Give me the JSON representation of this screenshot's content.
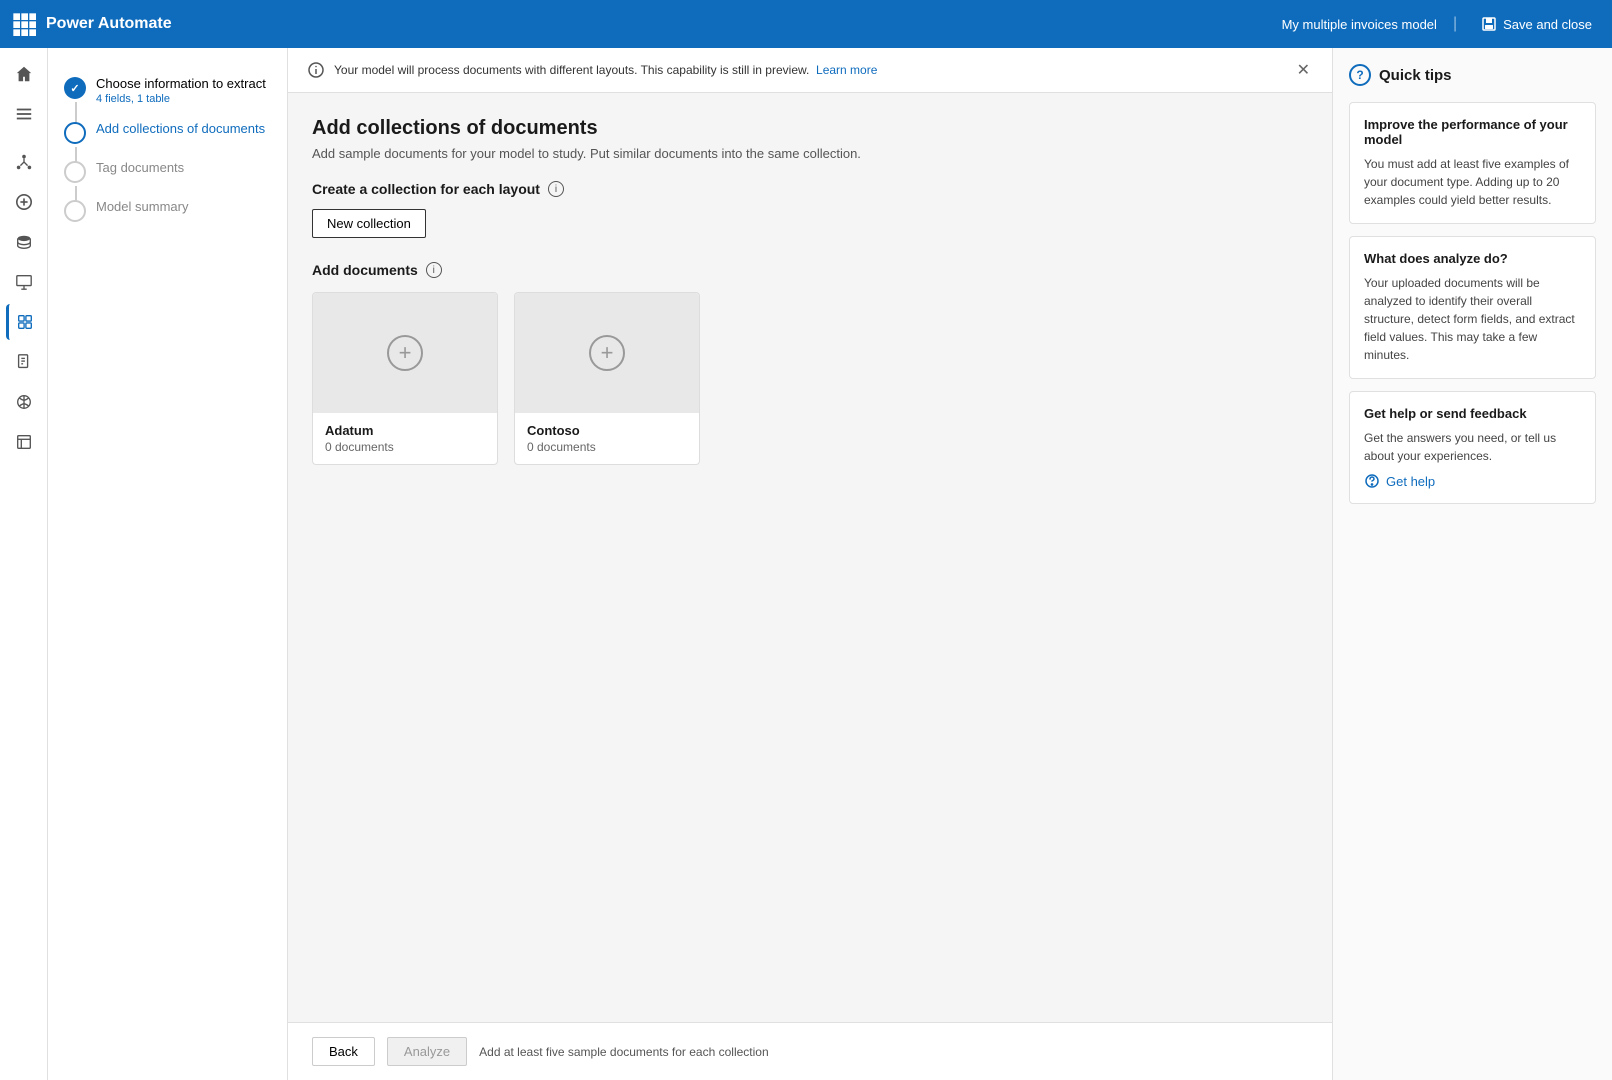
{
  "app": {
    "title": "Power Automate",
    "model_name": "My multiple invoices model",
    "save_close_label": "Save and close"
  },
  "banner": {
    "message": "Your model will process documents with different layouts. This capability is still in preview.",
    "learn_more": "Learn more"
  },
  "steps": [
    {
      "id": "choose-info",
      "title": "Choose information to extract",
      "subtitle": "4 fields, 1 table",
      "state": "completed"
    },
    {
      "id": "add-collections",
      "title": "Add collections of documents",
      "subtitle": "",
      "state": "active"
    },
    {
      "id": "tag-documents",
      "title": "Tag documents",
      "subtitle": "",
      "state": "inactive"
    },
    {
      "id": "model-summary",
      "title": "Model summary",
      "subtitle": "",
      "state": "inactive"
    }
  ],
  "main": {
    "page_title": "Add collections of documents",
    "page_subtitle": "Add sample documents for your model to study. Put similar documents into the same collection.",
    "create_collection_label": "Create a collection for each layout",
    "new_collection_btn": "New collection",
    "add_documents_label": "Add documents",
    "collections": [
      {
        "name": "Adatum",
        "doc_count": "0 documents"
      },
      {
        "name": "Contoso",
        "doc_count": "0 documents"
      }
    ]
  },
  "bottom_bar": {
    "back_label": "Back",
    "analyze_label": "Analyze",
    "hint": "Add at least five sample documents for each collection"
  },
  "quick_tips": {
    "title": "Quick tips",
    "tips": [
      {
        "title": "Improve the performance of your model",
        "text": "You must add at least five examples of your document type. Adding up to 20 examples could yield better results."
      },
      {
        "title": "What does analyze do?",
        "text": "Your uploaded documents will be analyzed to identify their overall structure, detect form fields, and extract field values. This may take a few minutes."
      },
      {
        "title": "Get help or send feedback",
        "text": "Get the answers you need, or tell us about your experiences."
      }
    ],
    "get_help_label": "Get help"
  }
}
